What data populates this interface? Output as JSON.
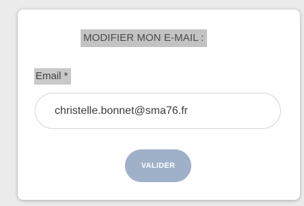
{
  "form": {
    "title": "MODIFIER MON E-MAIL :",
    "email_label": "Email *",
    "email_value": "christelle.bonnet@sma76.fr",
    "submit_label": "VALIDER"
  },
  "colors": {
    "background": "#ebebeb",
    "card": "#ffffff",
    "title_highlight": "#c3c3c3",
    "button": "#9fb1c9",
    "button_text": "#ffffff"
  }
}
